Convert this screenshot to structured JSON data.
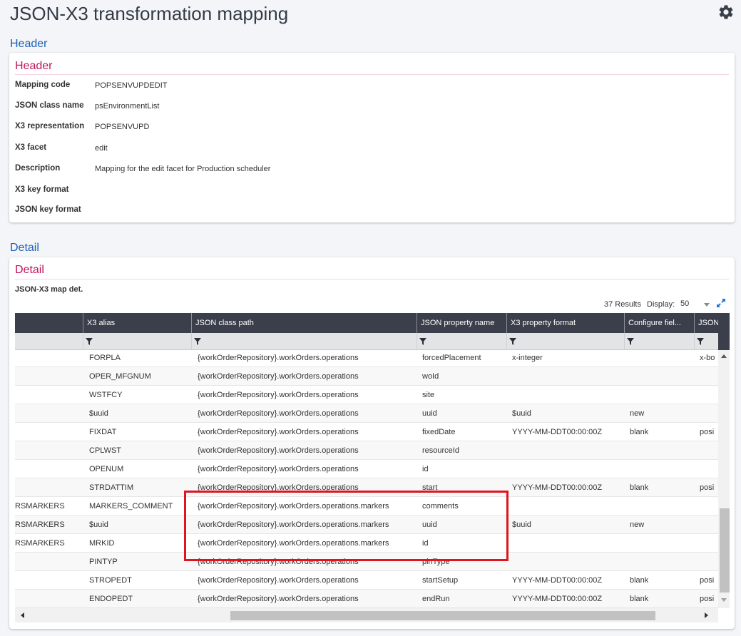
{
  "page": {
    "title": "JSON-X3 transformation mapping"
  },
  "header_section": {
    "link": "Header",
    "card_title": "Header",
    "fields": [
      {
        "label": "Mapping code",
        "value": "POPSENVUPDEDIT"
      },
      {
        "label": "JSON class name",
        "value": "psEnvironmentList"
      },
      {
        "label": "X3 representation",
        "value": "POPSENVUPD"
      },
      {
        "label": "X3 facet",
        "value": "edit"
      },
      {
        "label": "Description",
        "value": "Mapping for the edit facet for Production scheduler"
      },
      {
        "label": "X3 key format",
        "value": ""
      },
      {
        "label": "JSON key format",
        "value": ""
      }
    ]
  },
  "detail_section": {
    "link": "Detail",
    "card_title": "Detail",
    "grid_caption": "JSON-X3 map det.",
    "results": "37 Results",
    "display_label": "Display:",
    "display_value": "50",
    "columns": [
      "",
      "X3 alias",
      "JSON class path",
      "JSON property name",
      "X3 property format",
      "Configure fiel...",
      "JSON"
    ],
    "rows": [
      [
        "",
        "FORPLA",
        "{workOrderRepository}.workOrders.operations",
        "forcedPlacement",
        "x-integer",
        "",
        "x-bo"
      ],
      [
        "",
        "OPER_MFGNUM",
        "{workOrderRepository}.workOrders.operations",
        "woId",
        "",
        "",
        ""
      ],
      [
        "",
        "WSTFCY",
        "{workOrderRepository}.workOrders.operations",
        "site",
        "",
        "",
        ""
      ],
      [
        "",
        "$uuid",
        "{workOrderRepository}.workOrders.operations",
        "uuid",
        "$uuid",
        "new",
        ""
      ],
      [
        "",
        "FIXDAT",
        "{workOrderRepository}.workOrders.operations",
        "fixedDate",
        "YYYY-MM-DDT00:00:00Z",
        "blank",
        "posi"
      ],
      [
        "",
        "CPLWST",
        "{workOrderRepository}.workOrders.operations",
        "resourceId",
        "",
        "",
        ""
      ],
      [
        "",
        "OPENUM",
        "{workOrderRepository}.workOrders.operations",
        "id",
        "",
        "",
        ""
      ],
      [
        "",
        "STRDATTIM",
        "{workOrderRepository}.workOrders.operations",
        "start",
        "YYYY-MM-DDT00:00:00Z",
        "blank",
        "posi"
      ],
      [
        "RSMARKERS",
        "MARKERS_COMMENT",
        "{workOrderRepository}.workOrders.operations.markers",
        "comments",
        "",
        "",
        ""
      ],
      [
        "RSMARKERS",
        "$uuid",
        "{workOrderRepository}.workOrders.operations.markers",
        "uuid",
        "$uuid",
        "new",
        ""
      ],
      [
        "RSMARKERS",
        "MRKID",
        "{workOrderRepository}.workOrders.operations.markers",
        "id",
        "",
        "",
        ""
      ],
      [
        "",
        "PINTYP",
        "{workOrderRepository}.workOrders.operations",
        "pinType",
        "",
        "",
        ""
      ],
      [
        "",
        "STROPEDT",
        "{workOrderRepository}.workOrders.operations",
        "startSetup",
        "YYYY-MM-DDT00:00:00Z",
        "blank",
        "posi"
      ],
      [
        "",
        "ENDOPEDT",
        "{workOrderRepository}.workOrders.operations",
        "endRun",
        "YYYY-MM-DDT00:00:00Z",
        "blank",
        "posi"
      ]
    ]
  },
  "colors": {
    "link": "#1c5fb5",
    "card_title": "#c0145b",
    "grid_header": "#3a3f4b",
    "highlight": "#e0141e"
  }
}
